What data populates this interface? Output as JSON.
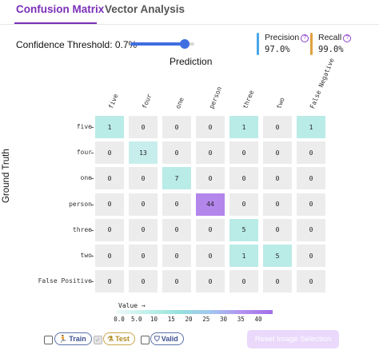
{
  "tabs": [
    {
      "label": "Confusion Matrix",
      "active": true
    },
    {
      "label": "Vector Analysis",
      "active": false
    }
  ],
  "threshold": {
    "label": "Confidence Threshold: 0.7%",
    "value_fraction": 0.85
  },
  "metrics": {
    "precision": {
      "label": "Precision",
      "value": "97.0%",
      "color": "#4aa8e8"
    },
    "recall": {
      "label": "Recall",
      "value": "99.0%",
      "color": "#e0a040"
    }
  },
  "axis": {
    "x_title": "Prediction",
    "y_title": "Ground Truth"
  },
  "matrix": {
    "columns": [
      "five",
      "four",
      "one",
      "person",
      "three",
      "two",
      "False Negative"
    ],
    "rows": [
      "five",
      "four",
      "one",
      "person",
      "three",
      "two",
      "False Positive"
    ],
    "values": [
      [
        1,
        0,
        0,
        0,
        1,
        0,
        1
      ],
      [
        0,
        13,
        0,
        0,
        0,
        0,
        0
      ],
      [
        0,
        0,
        7,
        0,
        0,
        0,
        0
      ],
      [
        0,
        0,
        0,
        44,
        0,
        0,
        0
      ],
      [
        0,
        0,
        0,
        0,
        5,
        0,
        0
      ],
      [
        0,
        0,
        0,
        0,
        1,
        5,
        0
      ],
      [
        0,
        0,
        0,
        0,
        0,
        0,
        0
      ]
    ],
    "cell_colors": {
      "zero": "#ececec",
      "low": "#c7eeec",
      "mid": "#b9ebe7",
      "high": "#b386ec"
    }
  },
  "legend": {
    "title": "Value →",
    "ticks": [
      "0.0",
      "5.0",
      "10",
      "15",
      "20",
      "25",
      "30",
      "35",
      "40"
    ],
    "tick_values": [
      0,
      5,
      10,
      15,
      20,
      25,
      30,
      35,
      40
    ]
  },
  "filters": [
    {
      "label": "Train",
      "icon": "running-person-icon",
      "checked": false
    },
    {
      "label": "Test",
      "icon": "flask-icon",
      "checked": true
    },
    {
      "label": "Valid",
      "icon": "shield-check-icon",
      "checked": false
    }
  ],
  "reset_button": {
    "label": "Reset Image Selection"
  }
}
